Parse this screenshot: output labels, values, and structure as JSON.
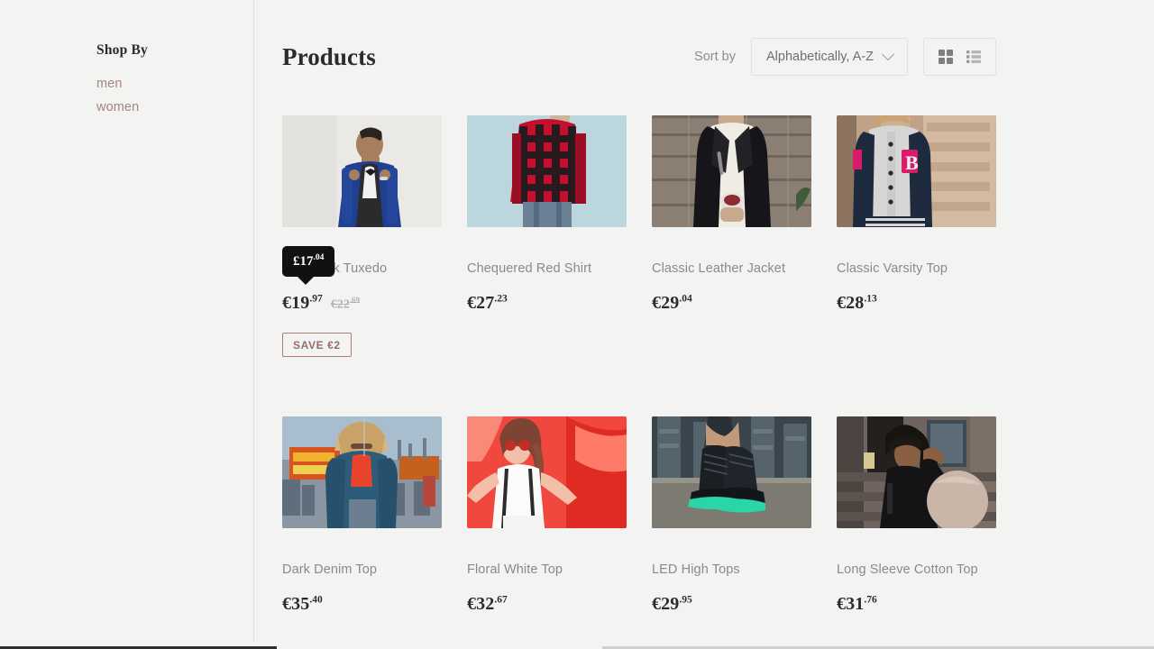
{
  "sidebar": {
    "title": "Shop By",
    "links": [
      {
        "label": "men"
      },
      {
        "label": "women"
      }
    ]
  },
  "toolbar": {
    "page_title": "Products",
    "sort_label": "Sort by",
    "sort_value": "Alphabetically, A-Z",
    "sort_options": [
      "Alphabetically, A-Z"
    ],
    "grid_view_icon": "grid-view-icon",
    "list_view_icon": "list-view-icon",
    "chevron_icon": "chevron-down-icon"
  },
  "tooltip": {
    "currency": "£",
    "amount": "17",
    "cents": ".04",
    "text": "£17.04"
  },
  "colors": {
    "background": "#f3f3f2",
    "accent_mauve": "#a58681",
    "badge_border": "#ab7d77",
    "badge_text": "#9a6b65",
    "title_text": "#2b2b2b",
    "muted_text": "#8a8a8a",
    "tooltip_bg": "#111112"
  },
  "products": [
    {
      "title": "Black Silk Tuxedo",
      "price_main": "€19",
      "price_cents": ".97",
      "old_price_main": "€22",
      "old_price_cents": ".69",
      "badge": "SAVE €2",
      "image": "man-blue-tuxedo"
    },
    {
      "title": "Chequered Red Shirt",
      "price_main": "€27",
      "price_cents": ".23",
      "old_price_main": "",
      "old_price_cents": "",
      "badge": "",
      "image": "red-check-flannel"
    },
    {
      "title": "Classic Leather Jacket",
      "price_main": "€29",
      "price_cents": ".04",
      "old_price_main": "",
      "old_price_cents": "",
      "badge": "",
      "image": "black-leather-jacket"
    },
    {
      "title": "Classic Varsity Top",
      "price_main": "€28",
      "price_cents": ".13",
      "old_price_main": "",
      "old_price_cents": "",
      "badge": "",
      "image": "grey-varsity-jacket"
    },
    {
      "title": "Dark Denim Top",
      "price_main": "€35",
      "price_cents": ".40",
      "old_price_main": "",
      "old_price_cents": "",
      "badge": "",
      "image": "denim-jacket-fairground"
    },
    {
      "title": "Floral White Top",
      "price_main": "€32",
      "price_cents": ".67",
      "old_price_main": "",
      "old_price_cents": "",
      "badge": "",
      "image": "white-top-red-backdrop"
    },
    {
      "title": "LED High Tops",
      "price_main": "€29",
      "price_cents": ".95",
      "old_price_main": "",
      "old_price_cents": "",
      "badge": "",
      "image": "led-sneakers"
    },
    {
      "title": "Long Sleeve Cotton Top",
      "price_main": "€31",
      "price_cents": ".76",
      "old_price_main": "",
      "old_price_cents": "",
      "badge": "",
      "image": "black-long-sleeve-top"
    }
  ]
}
